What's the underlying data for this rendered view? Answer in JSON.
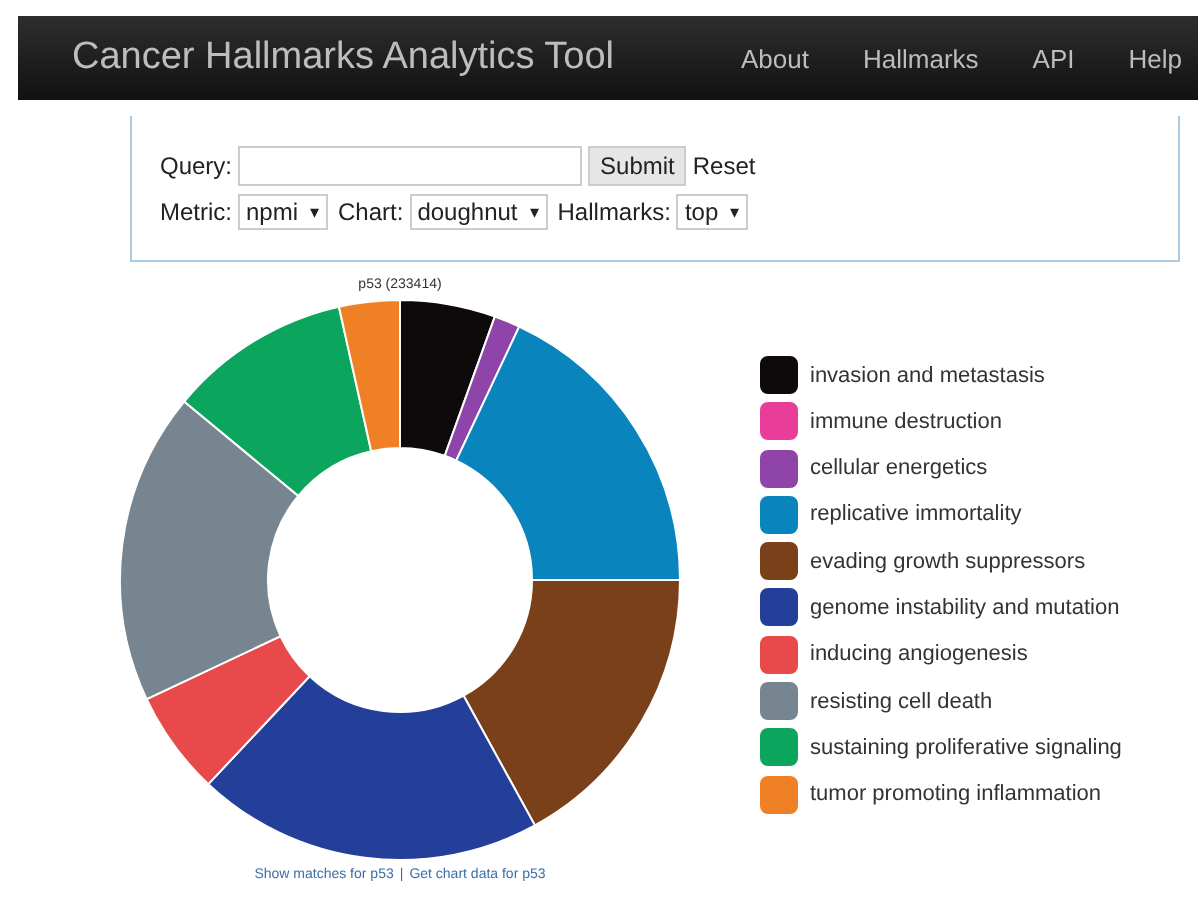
{
  "navbar": {
    "brand": "Cancer Hallmarks Analytics Tool",
    "links": [
      "About",
      "Hallmarks",
      "API",
      "Help"
    ]
  },
  "form": {
    "query_label": "Query:",
    "submit": "Submit",
    "reset": "Reset",
    "selects": [
      {
        "label": "Metric:",
        "value": "npmi"
      },
      {
        "label": "Chart:",
        "value": "doughnut"
      },
      {
        "label": "Hallmarks:",
        "value": "top"
      }
    ],
    "caret": "▾"
  },
  "chart": {
    "title": "p53 (233414)",
    "links": [
      "Show matches for p53",
      "Get chart data for p53"
    ],
    "separator": "|"
  },
  "legend": [
    {
      "label": "invasion and metastasis",
      "color": "#0e0a0c"
    },
    {
      "label": "immune destruction",
      "color": "#e83e9a"
    },
    {
      "label": "cellular energetics",
      "color": "#8e44a8"
    },
    {
      "label": "replicative immortality",
      "color": "#0a84bd"
    },
    {
      "label": "evading growth suppressors",
      "color": "#7a4019"
    },
    {
      "label": "genome instability and mutation",
      "color": "#233f9a"
    },
    {
      "label": "inducing angiogenesis",
      "color": "#e8494a"
    },
    {
      "label": "resisting cell death",
      "color": "#76858f"
    },
    {
      "label": "sustaining proliferative signaling",
      "color": "#0ca55e"
    },
    {
      "label": "tumor promoting inflammation",
      "color": "#f08026"
    }
  ]
}
